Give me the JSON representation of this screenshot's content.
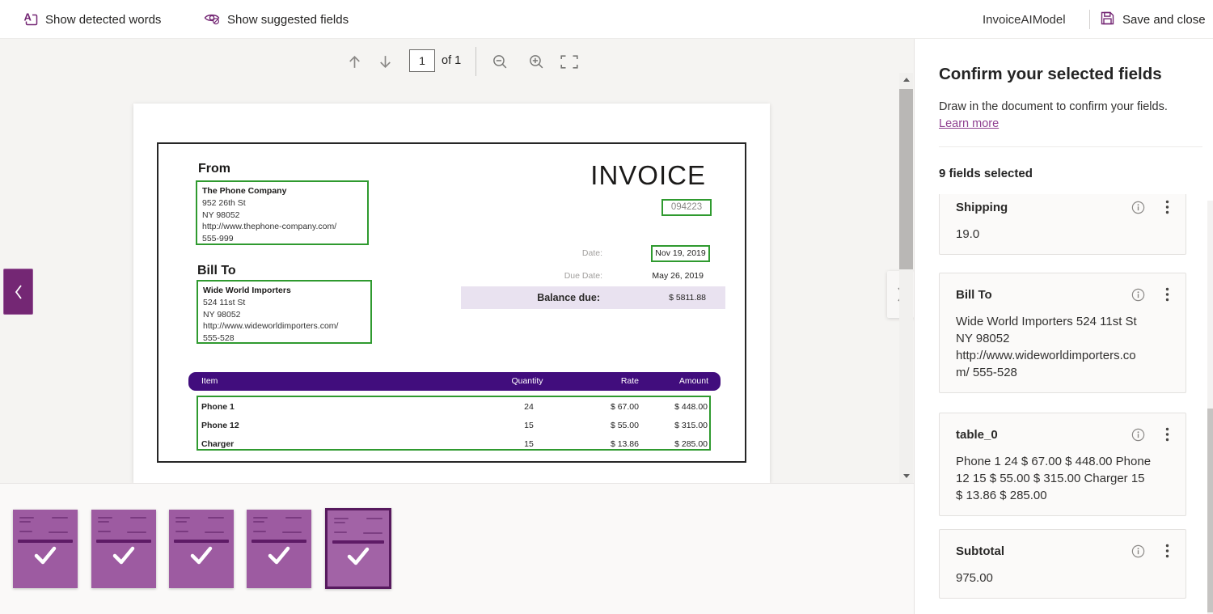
{
  "topbar": {
    "show_detected_words": "Show detected words",
    "show_suggested_fields": "Show suggested fields",
    "model_name": "InvoiceAIModel",
    "save_and_close": "Save and close"
  },
  "doc_toolbar": {
    "page_value": "1",
    "page_of": "of 1"
  },
  "invoice": {
    "from_heading": "From",
    "from_lines": [
      "The Phone Company",
      "952 26th St",
      "NY 98052",
      "http://www.thephone-company.com/",
      "555-999"
    ],
    "title": "INVOICE",
    "number": "094223",
    "date_label": "Date:",
    "date_value": "Nov 19, 2019",
    "due_date_label": "Due Date:",
    "due_date_value": "May 26, 2019",
    "balance_label": "Balance due:",
    "balance_value": "$ 5811.88",
    "bill_to_heading": "Bill To",
    "bill_to_lines": [
      "Wide World Importers",
      "524 11st St",
      "NY 98052",
      "http://www.wideworldimporters.com/",
      "555-528"
    ],
    "table": {
      "headers": [
        "Item",
        "Quantity",
        "Rate",
        "Amount"
      ],
      "rows": [
        {
          "item": "Phone 1",
          "quantity": "24",
          "rate": "$ 67.00",
          "amount": "$ 448.00"
        },
        {
          "item": "Phone 12",
          "quantity": "15",
          "rate": "$ 55.00",
          "amount": "$ 315.00"
        },
        {
          "item": "Charger",
          "quantity": "15",
          "rate": "$ 13.86",
          "amount": "$ 285.00"
        }
      ]
    }
  },
  "panel": {
    "title": "Confirm your selected fields",
    "description": "Draw in the document to confirm your fields.",
    "learn_more": "Learn more",
    "fields_selected": "9 fields selected",
    "cards": [
      {
        "name": "Shipping",
        "value": "19.0"
      },
      {
        "name": "Bill To",
        "value": "Wide World Importers 524 11st St\nNY 98052\nhttp://www.wideworldimporters.co\nm/ 555-528"
      },
      {
        "name": "table_0",
        "value": "Phone 1 24 $ 67.00 $ 448.00 Phone\n12 15 $ 55.00 $ 315.00 Charger 15\n$ 13.86 $ 285.00"
      },
      {
        "name": "Subtotal",
        "value": "975.00"
      }
    ]
  },
  "thumbnails": {
    "count": 5,
    "selected": 5
  },
  "colors": {
    "accent": "#742774",
    "table_header": "#410d7d",
    "field_box_green": "#2f9a2f"
  }
}
